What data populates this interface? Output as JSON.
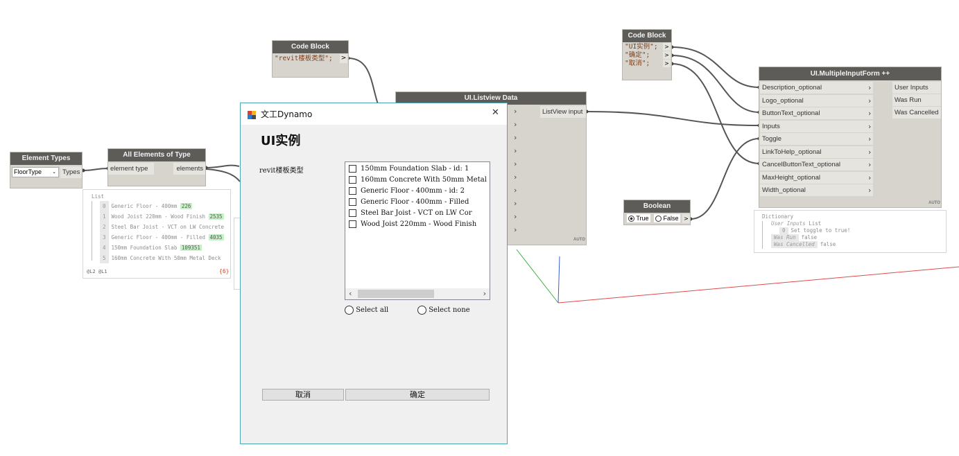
{
  "canvas": {
    "element_types": {
      "title": "Element Types",
      "dropdown_value": "FloorType",
      "output": "Types"
    },
    "all_elements": {
      "title": "All Elements of Type",
      "input": "element type",
      "output": "elements"
    },
    "list_preview": {
      "header": "List",
      "items": [
        {
          "index": "0",
          "text": "Generic Floor - 400mm",
          "id": "226"
        },
        {
          "index": "1",
          "text": "Wood Joist 220mm - Wood Finish",
          "id": "2535"
        },
        {
          "index": "2",
          "text": "Steel Bar Joist - VCT on LW Concrete",
          "id": ""
        },
        {
          "index": "3",
          "text": "Generic Floor - 400mm - Filled",
          "id": "4035"
        },
        {
          "index": "4",
          "text": "150mm Foundation Slab",
          "id": "109351"
        },
        {
          "index": "5",
          "text": "160mm Concrete With 50mm Metal Deck",
          "id": ""
        }
      ],
      "footer_left": "@L2 @L1",
      "footer_right": "{6}"
    },
    "code_block_1": {
      "title": "Code Block",
      "code": "\"revit楼板类型\";",
      "output": ">"
    },
    "listview": {
      "title": "UI.Listview Data",
      "output": "ListView input",
      "auto": "AUTO"
    },
    "code_block_2": {
      "title": "Code Block",
      "lines": [
        "\"UI实例\";",
        "\"确定\";",
        "\"取消\";"
      ]
    },
    "boolean": {
      "title": "Boolean",
      "true_label": "True",
      "false_label": "False",
      "selected": "True"
    },
    "mif": {
      "title": "UI.MultipleInputForm ++",
      "inputs": [
        "Description_optional",
        "Logo_optional",
        "ButtonText_optional",
        "Inputs",
        "Toggle",
        "LinkToHelp_optional",
        "CancelButtonText_optional",
        "MaxHeight_optional",
        "Width_optional"
      ],
      "outputs": [
        "User Inputs",
        "Was Run",
        "Was Cancelled"
      ],
      "auto": "AUTO"
    },
    "dict_preview": {
      "header": "Dictionary",
      "user_inputs_key": "User Inputs",
      "user_inputs_type": "List",
      "toggle_index": "0",
      "toggle_text": "Set toggle to true!",
      "was_run_key": "Was Run",
      "was_run_value": "false",
      "was_cancelled_key": "Was Cancelled",
      "was_cancelled_value": "false"
    }
  },
  "dialog": {
    "title": "文工Dynamo",
    "heading": "UI实例",
    "field_label": "revit楼板类型",
    "items": [
      "150mm Foundation Slab  -  id: 1",
      "160mm Concrete With 50mm Metal",
      "Generic Floor - 400mm  -  id: 2",
      "Generic Floor - 400mm - Filled",
      "Steel Bar Joist - VCT on LW Cor",
      "Wood Joist 220mm - Wood Finish"
    ],
    "select_all": "Select all",
    "select_none": "Select none",
    "cancel_button": "取消",
    "ok_button": "确定",
    "close_glyph": "✕",
    "icon": "dynamo-app-icon"
  }
}
